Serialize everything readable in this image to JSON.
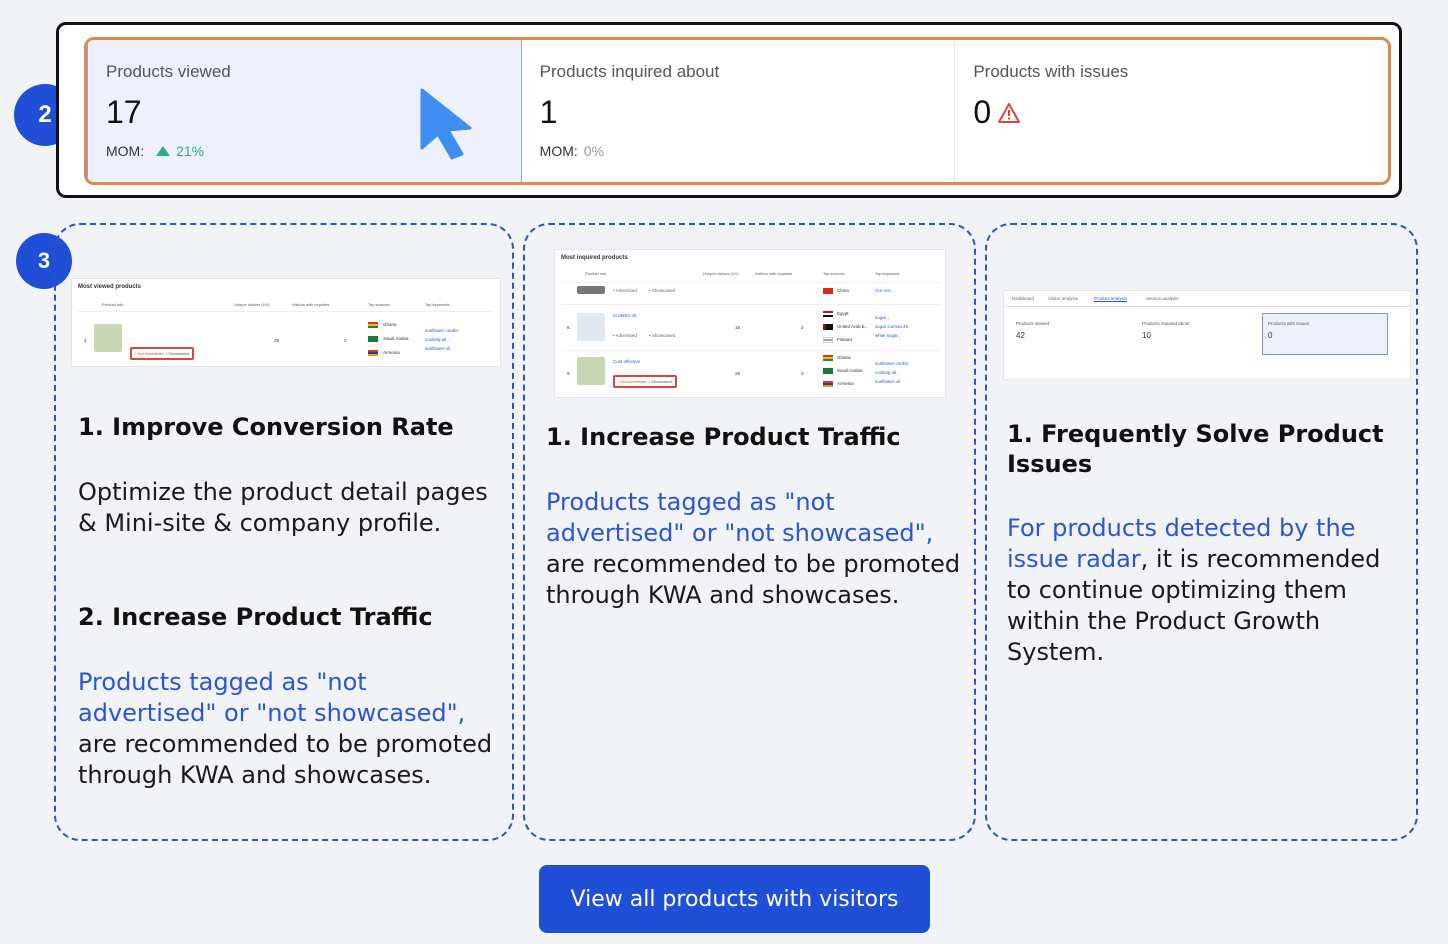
{
  "steps": {
    "step2": "2",
    "step3": "3"
  },
  "metrics": [
    {
      "label": "Products viewed",
      "value": "17",
      "mom_label": "MOM:",
      "mom_value": "21%",
      "trend": "up"
    },
    {
      "label": "Products inquired about",
      "value": "1",
      "mom_label": "MOM:",
      "mom_value": "0%"
    },
    {
      "label": "Products with issues",
      "value": "0",
      "icon": "warning-icon"
    }
  ],
  "cards": [
    {
      "screenshot": {
        "title": "Most viewed products",
        "headers": [
          "Product info",
          "Unique visitors (UV)",
          "Visitors with inquiries",
          "Top sources",
          "Top keywords"
        ],
        "row": {
          "index": "4.",
          "uv": "29",
          "inquiries": "2",
          "sources": [
            "Ghana",
            "Saudi Arabia",
            "Armenia"
          ],
          "keywords": [
            "sunflower cookin",
            "cooking oil ,",
            "sunflower oil ,"
          ],
          "tags": [
            "• Not Advertised",
            "• Showcased"
          ]
        }
      },
      "heading1": "1.   Improve Conversion Rate",
      "para1": "Optimize the product detail pages & Mini-site & company profile.",
      "heading2": "2. Increase Product Traffic",
      "para2_blue": "Products tagged as \"not advertised\" or \"not showcased\",",
      "para2_rest": " are recommended to be promoted through KWA and showcases."
    },
    {
      "screenshot": {
        "title": "Most inquired products",
        "headers": [
          "Product info",
          "Unique visitors (UV)",
          "Visitors with inquiries",
          "Top sources",
          "Top keywords"
        ],
        "rows": [
          {
            "tags": [
              "• Advertised",
              "• Showcased"
            ],
            "sources": [
              "China"
            ],
            "keywords": [
              "rice rice ,"
            ]
          },
          {
            "index": "8.",
            "name": "ICUMSA 45",
            "uv": "15",
            "inquiries": "2",
            "tags": [
              "• Advertised",
              "• Showcased"
            ],
            "sources": [
              "Egypt",
              "United Arab E...",
              "Finland"
            ],
            "keywords": [
              "sugar ,",
              "sugar icumsa 45 ,",
              "white sugar ,"
            ]
          },
          {
            "index": "9.",
            "name": "Cost effective",
            "uv": "29",
            "inquiries": "2",
            "tags": [
              "• Not Advertised",
              "• Showcased"
            ],
            "sources": [
              "Ghana",
              "Saudi Arabia",
              "Armenia"
            ],
            "keywords": [
              "sunflower cookin",
              "cooking oil ,",
              "sunflower oil"
            ]
          }
        ]
      },
      "heading1": "1. Increase Product Traffic",
      "para1_blue": "Products tagged as \"not advertised\" or \"not showcased\",",
      "para1_rest": " are recommended to be promoted through KWA and showcases."
    },
    {
      "screenshot": {
        "tabs": [
          "Dashboard",
          "Visitor analysis",
          "Product analysis",
          "Service analysis"
        ],
        "metrics": [
          {
            "label": "Products viewed",
            "value": "42"
          },
          {
            "label": "Products inquired about",
            "value": "10"
          },
          {
            "label": "Products with issues",
            "value": "0"
          }
        ]
      },
      "heading1": "1. Frequently Solve Product Issues",
      "para1_blue": "For products detected by the issue radar",
      "para1_rest": ", it is recommended to continue optimizing them within the Product Growth System."
    }
  ],
  "cta": {
    "label": "View all products with visitors"
  },
  "colors": {
    "accent": "#1f4fd6",
    "highlight": "#e08a4a",
    "link": "#2a56d6",
    "up": "#25b08a",
    "warn": "#d8473b"
  }
}
